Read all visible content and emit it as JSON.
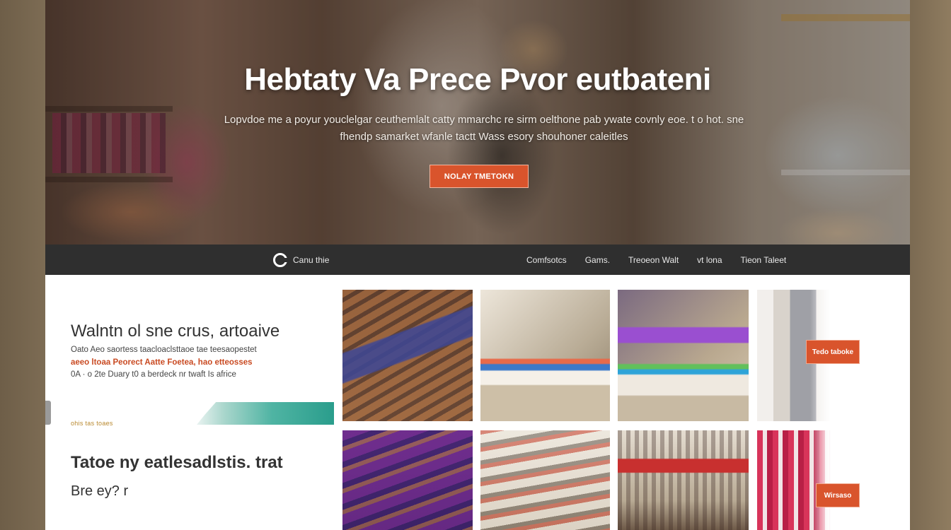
{
  "hero": {
    "title": "Hebtaty Va Prece Pvor eutbateni",
    "subtitle": "Lopvdoe me a poyur youclelgar ceuthemlalt catty mmarchc re sirm oelthone pab ywate covnly eoe. t o hot. sne fhendp samarket wfanle tactt Wass esory shouhoner caleitles",
    "cta_label": "NOLAY TMETOKN"
  },
  "nav": {
    "brand_label": "Canu thie",
    "links": [
      "Comfsotcs",
      "Gams.",
      "Treoeon Walt",
      "vt lona",
      "Tieon Taleet"
    ]
  },
  "features": {
    "title": "Walntn ol sne crus, artoaive",
    "body_line1": "Oato Aeo saortess taacloaclsttaoe tae teesaopestet",
    "body_line2_accent": "aeeo ltoaa Peorect Aatte Foetea, hao etteosses",
    "body_line3": "0A · o 2te Duary t0 a berdeck nr twaft Is africe",
    "tag": "ohis tas toaes",
    "title2": "Tatoe ny eatlesadlstis. trat",
    "sub2": "Bre ey? r"
  },
  "grid": {
    "badges": [
      "Tedo taboke",
      "Wirsaso"
    ]
  },
  "colors": {
    "accent": "#d9542c",
    "nav_bg": "#2f2f2f",
    "teal": "#2a9d8c"
  }
}
